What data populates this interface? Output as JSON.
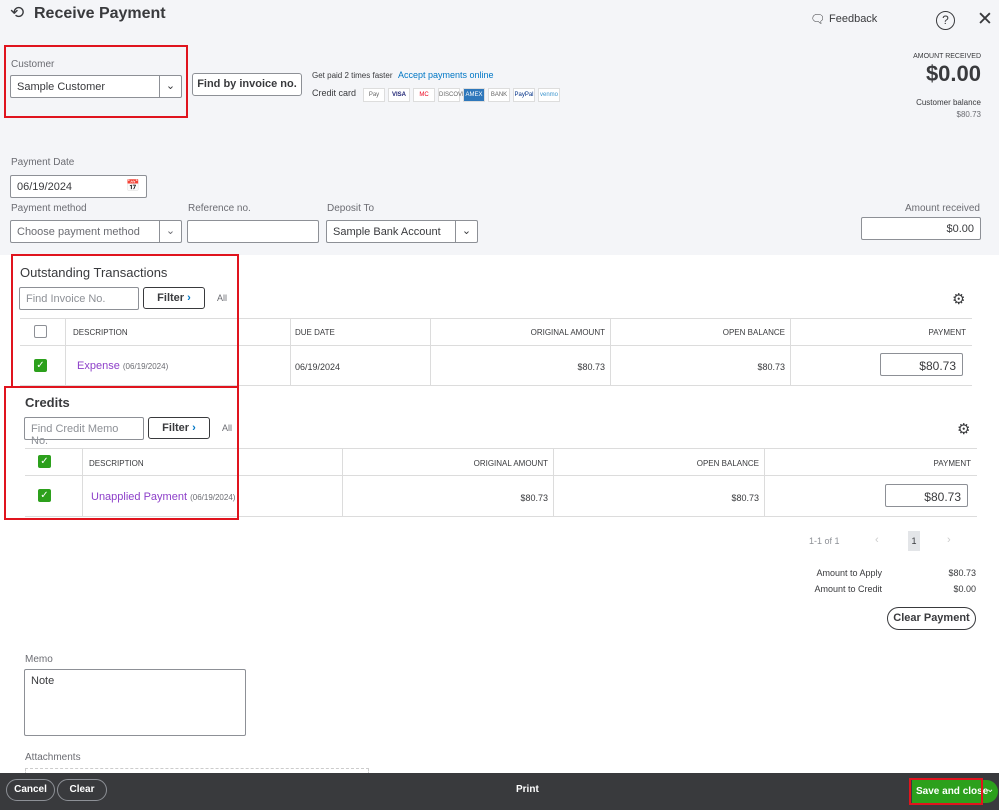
{
  "header": {
    "title": "Receive Payment",
    "feedback": "Feedback",
    "icons": [
      "history-icon",
      "feedback-icon",
      "help-icon",
      "close-icon"
    ]
  },
  "customer": {
    "label": "Customer",
    "value": "Sample Customer",
    "find_button": "Find by invoice no."
  },
  "promo": {
    "text": "Get paid 2 times faster",
    "link": "Accept payments online",
    "credit_label": "Credit card",
    "cards": [
      "Pay",
      "VISA",
      "MC",
      "DISCOVER",
      "AMEX",
      "BANK",
      "PayPal",
      "venmo"
    ]
  },
  "amount": {
    "label": "AMOUNT RECEIVED",
    "value": "$0.00",
    "balance_label": "Customer balance",
    "balance": "$80.73"
  },
  "payment_date": {
    "label": "Payment Date",
    "value": "06/19/2024"
  },
  "payment_method": {
    "label": "Payment method",
    "placeholder": "Choose payment method"
  },
  "reference": {
    "label": "Reference no.",
    "value": ""
  },
  "deposit": {
    "label": "Deposit To",
    "value": "Sample Bank Account"
  },
  "amount_received": {
    "label": "Amount received",
    "value": "$0.00"
  },
  "outstanding": {
    "title": "Outstanding Transactions",
    "search_placeholder": "Find Invoice No.",
    "filter": "Filter",
    "all": "All",
    "columns": [
      "DESCRIPTION",
      "DUE DATE",
      "ORIGINAL AMOUNT",
      "OPEN BALANCE",
      "PAYMENT"
    ],
    "rows": [
      {
        "checked": true,
        "desc": "Expense",
        "date": "(06/19/2024)",
        "due": "06/19/2024",
        "original": "$80.73",
        "open": "$80.73",
        "payment": "$80.73"
      }
    ]
  },
  "credits": {
    "title": "Credits",
    "search_placeholder": "Find Credit Memo No.",
    "filter": "Filter",
    "all": "All",
    "columns": [
      "DESCRIPTION",
      "ORIGINAL AMOUNT",
      "OPEN BALANCE",
      "PAYMENT"
    ],
    "rows": [
      {
        "checked": true,
        "desc": "Unapplied Payment",
        "date": "(06/19/2024)",
        "original": "$80.73",
        "open": "$80.73",
        "payment": "$80.73"
      }
    ]
  },
  "pagination": {
    "range": "1-1 of 1",
    "page": "1"
  },
  "totals": {
    "apply_label": "Amount to Apply",
    "apply": "$80.73",
    "credit_label": "Amount to Credit",
    "credit": "$0.00",
    "clear": "Clear Payment"
  },
  "memo": {
    "label": "Memo",
    "value": "Note"
  },
  "attachments": {
    "label": "Attachments"
  },
  "footer": {
    "cancel": "Cancel",
    "clear": "Clear",
    "print": "Print",
    "save": "Save and close"
  },
  "colors": {
    "accent": "#2ca01c",
    "link": "#8d3fc9",
    "highlight": "#e0141e",
    "footer": "#393a3d"
  }
}
